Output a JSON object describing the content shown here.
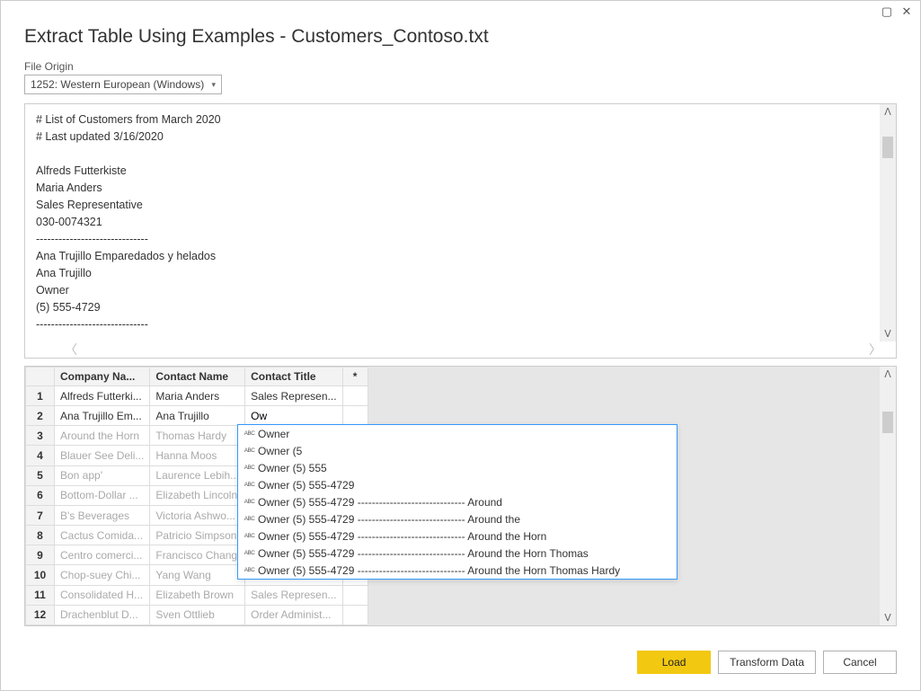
{
  "window": {
    "title": "Extract Table Using Examples - Customers_Contoso.txt"
  },
  "fileOrigin": {
    "label": "File Origin",
    "value": "1252: Western European (Windows)"
  },
  "preview": {
    "lines": [
      "# List of Customers from March 2020",
      "# Last updated 3/16/2020",
      "",
      "Alfreds Futterkiste",
      "Maria Anders",
      "Sales Representative",
      "030-0074321",
      "------------------------------",
      "Ana Trujillo Emparedados y helados",
      "Ana Trujillo",
      "Owner",
      "(5) 555-4729",
      "------------------------------"
    ]
  },
  "grid": {
    "headers": {
      "rownum": "",
      "company": "Company Na...",
      "contact": "Contact Name",
      "title": "Contact Title",
      "star": "*"
    },
    "editingValue": "Ow",
    "rows": [
      {
        "n": "1",
        "company": "Alfreds Futterki...",
        "contact": "Maria Anders",
        "title": "Sales Represen...",
        "faded": false
      },
      {
        "n": "2",
        "company": "Ana Trujillo Em...",
        "contact": "Ana Trujillo",
        "title": "",
        "faded": false,
        "editing": true
      },
      {
        "n": "3",
        "company": "Around the Horn",
        "contact": "Thomas Hardy",
        "title": "",
        "faded": true
      },
      {
        "n": "4",
        "company": "Blauer See Deli...",
        "contact": "Hanna Moos",
        "title": "",
        "faded": true
      },
      {
        "n": "5",
        "company": "Bon app'",
        "contact": "Laurence Lebih...",
        "title": "",
        "faded": true
      },
      {
        "n": "6",
        "company": "Bottom-Dollar ...",
        "contact": "Elizabeth Lincoln",
        "title": "",
        "faded": true
      },
      {
        "n": "7",
        "company": "B's Beverages",
        "contact": "Victoria Ashwo...",
        "title": "",
        "faded": true
      },
      {
        "n": "8",
        "company": "Cactus Comida...",
        "contact": "Patricio Simpson",
        "title": "",
        "faded": true
      },
      {
        "n": "9",
        "company": "Centro comerci...",
        "contact": "Francisco Chang",
        "title": "",
        "faded": true
      },
      {
        "n": "10",
        "company": "Chop-suey Chi...",
        "contact": "Yang Wang",
        "title": "",
        "faded": true
      },
      {
        "n": "11",
        "company": "Consolidated H...",
        "contact": "Elizabeth Brown",
        "title": "Sales Represen...",
        "faded": true
      },
      {
        "n": "12",
        "company": "Drachenblut D...",
        "contact": "Sven Ottlieb",
        "title": "Order Administ...",
        "faded": true
      }
    ]
  },
  "autocomplete": {
    "options": [
      "Owner",
      "Owner (5",
      "Owner (5) 555",
      "Owner (5) 555-4729",
      "Owner (5) 555-4729 ------------------------------ Around",
      "Owner (5) 555-4729 ------------------------------ Around the",
      "Owner (5) 555-4729 ------------------------------ Around the Horn",
      "Owner (5) 555-4729 ------------------------------ Around the Horn Thomas",
      "Owner (5) 555-4729 ------------------------------ Around the Horn Thomas Hardy"
    ]
  },
  "footer": {
    "load": "Load",
    "transform": "Transform Data",
    "cancel": "Cancel"
  }
}
